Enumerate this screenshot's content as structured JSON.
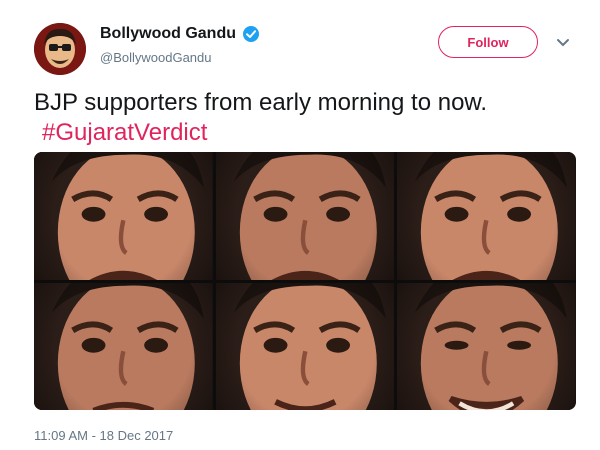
{
  "author": {
    "display_name": "Bollywood Gandu",
    "handle": "@BollywoodGandu",
    "verified": true,
    "avatar_icon": "cartoon-face-avatar-icon"
  },
  "follow_label": "Follow",
  "tweet": {
    "text": "BJP supporters from early morning to now.",
    "hashtag": "#GujaratVerdict"
  },
  "media": {
    "rows": 2,
    "columns": 3,
    "panels": [
      {
        "expression": "crying"
      },
      {
        "expression": "crying"
      },
      {
        "expression": "crying"
      },
      {
        "expression": "sad"
      },
      {
        "expression": "slight-smile"
      },
      {
        "expression": "smiling"
      }
    ]
  },
  "timestamp": "11:09 AM - 18 Dec 2017",
  "colors": {
    "accent": "#e0245e",
    "verified": "#1da1f2",
    "secondary_text": "#657786"
  }
}
